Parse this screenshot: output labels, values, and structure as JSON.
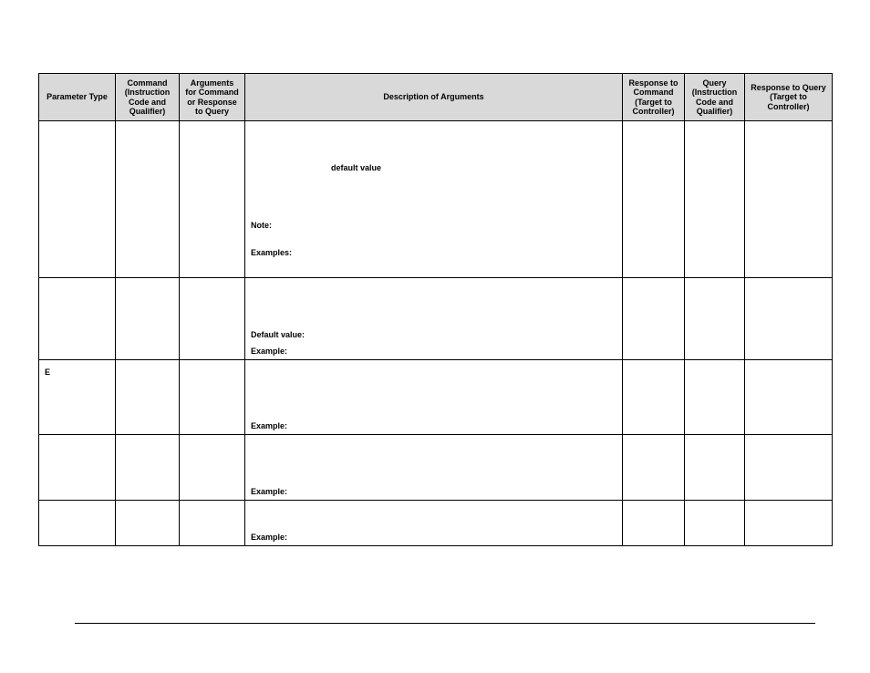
{
  "headers": {
    "c1": "Parameter Type",
    "c2": "Command (Instruction Code and Qualifier)",
    "c3": "Arguments for Command or Response to Query",
    "c4": "Description of Arguments",
    "c5": "Response to Command (Target to Controller)",
    "c6": "Query (Instruction Code and Qualifier)",
    "c7": "Response to Query (Target to Controller)"
  },
  "rows": [
    {
      "param": "",
      "desc_default_value": "default value",
      "desc_note": "Note:",
      "desc_examples": "Examples:"
    },
    {
      "param": "",
      "desc_default_label": "Default value:",
      "desc_example": "Example:"
    },
    {
      "param": "E",
      "desc_example": "Example:"
    },
    {
      "param": "",
      "desc_example": "Example:"
    },
    {
      "param": "",
      "desc_example": "Example:"
    }
  ]
}
